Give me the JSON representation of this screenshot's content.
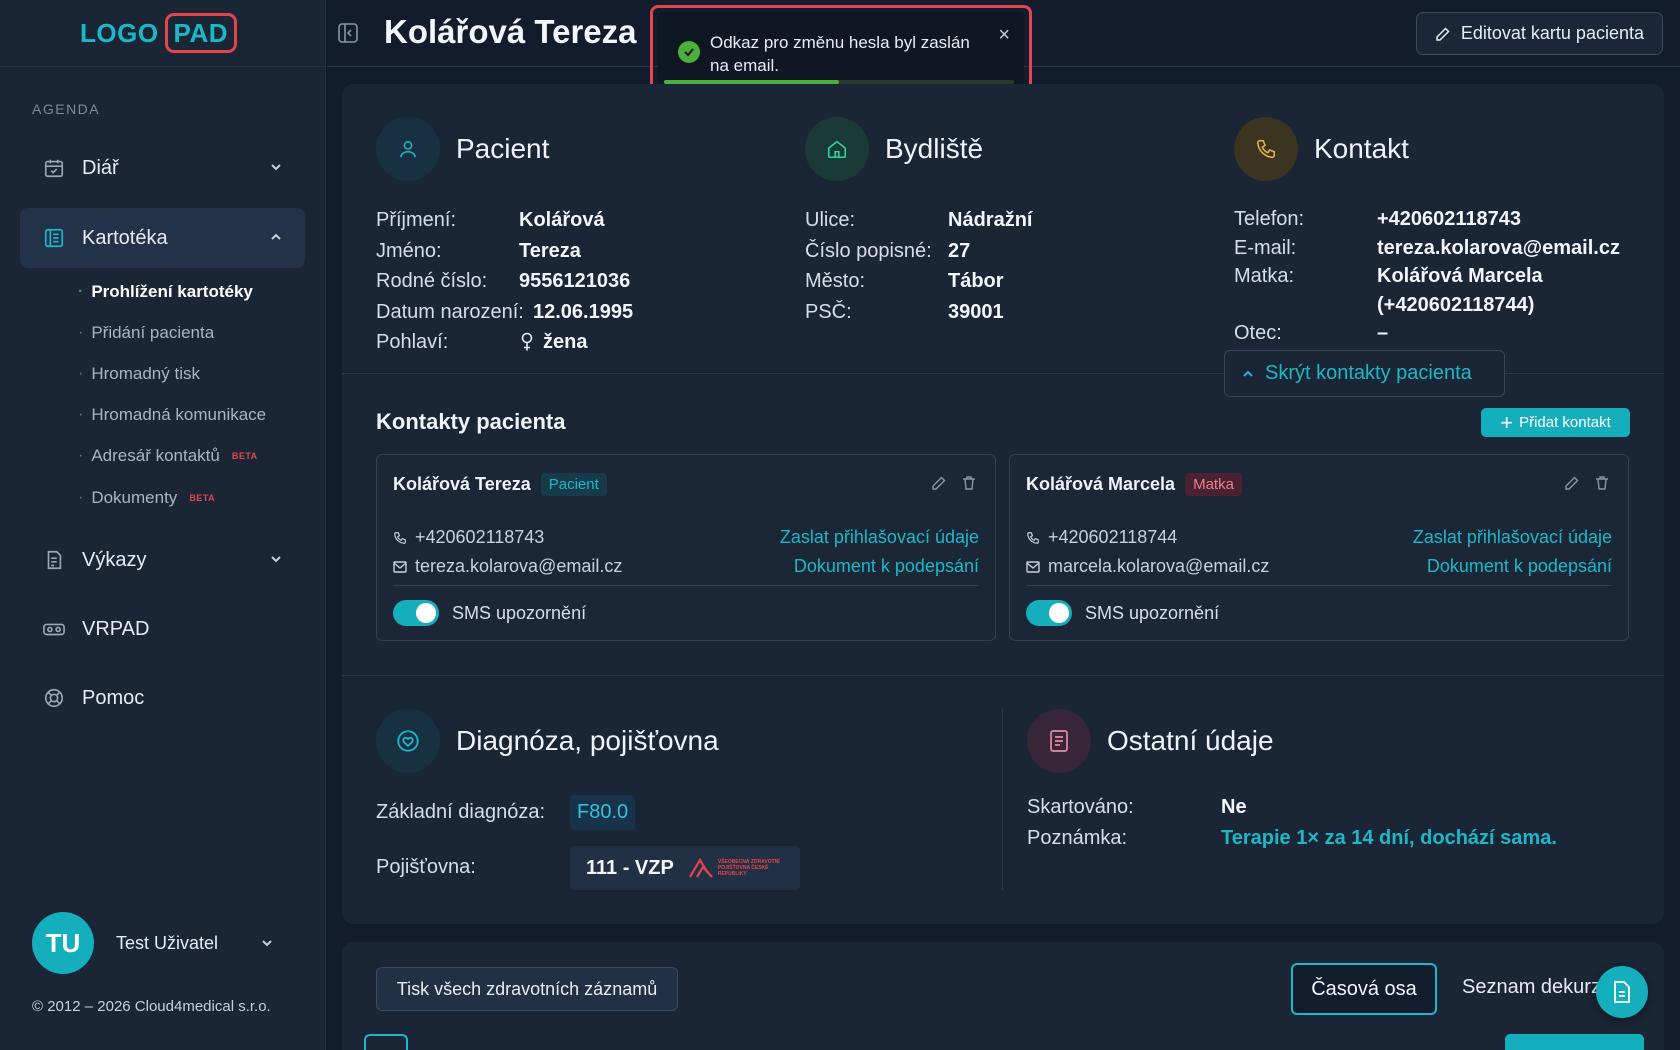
{
  "logo": {
    "part1": "LOGO",
    "part2": "PAD"
  },
  "sidebar": {
    "section_label": "AGENDA",
    "items": [
      {
        "label": "Diář",
        "icon": "calendar-icon"
      },
      {
        "label": "Kartotéka",
        "icon": "card-index-icon"
      },
      {
        "label": "Výkazy",
        "icon": "report-icon"
      },
      {
        "label": "VRPAD",
        "icon": "vr-headset-icon"
      },
      {
        "label": "Pomoc",
        "icon": "lifebuoy-icon"
      }
    ],
    "subitems": [
      {
        "label": "Prohlížení kartotéky"
      },
      {
        "label": "Přidání pacienta"
      },
      {
        "label": "Hromadný tisk"
      },
      {
        "label": "Hromadná komunikace"
      },
      {
        "label": "Adresář kontaktů",
        "badge": "BETA"
      },
      {
        "label": "Dokumenty",
        "badge": "BETA"
      }
    ]
  },
  "user": {
    "initials": "TU",
    "name": "Test Uživatel"
  },
  "copyright": "© 2012 – 2026 Cloud4medical s.r.o.",
  "header": {
    "title": "Kolářová Tereza",
    "edit_button": "Editovat kartu pacienta"
  },
  "toast": {
    "message": "Odkaz pro změnu hesla byl zaslán na email.",
    "close": "×",
    "progress": 0.5
  },
  "patient": {
    "title": "Pacient",
    "rows": [
      {
        "k": "Příjmení:",
        "v": "Kolářová"
      },
      {
        "k": "Jméno:",
        "v": "Tereza"
      },
      {
        "k": "Rodné číslo:",
        "v": "9556121036"
      },
      {
        "k": "Datum narození:",
        "v": "12.06.1995"
      },
      {
        "k": "Pohlaví:",
        "v": "žena"
      }
    ]
  },
  "residence": {
    "title": "Bydliště",
    "rows": [
      {
        "k": "Ulice:",
        "v": "Nádražní"
      },
      {
        "k": "Číslo popisné:",
        "v": "27"
      },
      {
        "k": "Město:",
        "v": "Tábor"
      },
      {
        "k": "PSČ:",
        "v": "39001"
      }
    ]
  },
  "contact": {
    "title": "Kontakt",
    "rows": [
      {
        "k": "Telefon:",
        "v": "+420602118743"
      },
      {
        "k": "E-mail:",
        "v": "tereza.kolarova@email.cz"
      },
      {
        "k": "Matka:",
        "v": "Kolářová Marcela"
      },
      {
        "k": "",
        "v": "(+420602118744)"
      },
      {
        "k": "Otec:",
        "v": "–"
      }
    ]
  },
  "hide_contacts": "Skrýt kontakty pacienta",
  "contacts": {
    "title": "Kontakty pacienta",
    "add_button": "Přidat kontakt",
    "cards": [
      {
        "name": "Kolářová Tereza",
        "badge": "Pacient",
        "phone": "+420602118743",
        "email": "tereza.kolarova@email.cz",
        "link1": "Zaslat přihlašovací údaje",
        "link2": "Dokument k podepsání",
        "toggle_label": "SMS upozornění",
        "sms_enabled": true
      },
      {
        "name": "Kolářová Marcela",
        "badge": "Matka",
        "phone": "+420602118744",
        "email": "marcela.kolarova@email.cz",
        "link1": "Zaslat přihlašovací údaje",
        "link2": "Dokument k podepsání",
        "toggle_label": "SMS upozornění",
        "sms_enabled": true
      }
    ]
  },
  "diagnosis": {
    "title": "Diagnóza, pojišťovna",
    "diag_label": "Základní diagnóza:",
    "diag_code": "F80.0",
    "ins_label": "Pojišťovna:",
    "ins_value": "111 - VZP",
    "ins_logo_text": "VŠEOBECNÁ ZDRAVOTNÍ POJIŠŤOVNA ČESKÉ REPUBLIKY"
  },
  "other": {
    "title": "Ostatní údaje",
    "rows": [
      {
        "k": "Skartováno:",
        "v": "Ne"
      },
      {
        "k": "Poznámka:",
        "v": "Terapie 1× za 14 dní, dochází sama."
      }
    ]
  },
  "bottom": {
    "print_button": "Tisk všech zdravotních záznamů",
    "timeline_tab": "Časová osa",
    "decursus_tab": "Seznam dekurzů"
  },
  "colors": {
    "accent": "#14aebc",
    "danger": "#e2464c",
    "success": "#4caf3b"
  }
}
